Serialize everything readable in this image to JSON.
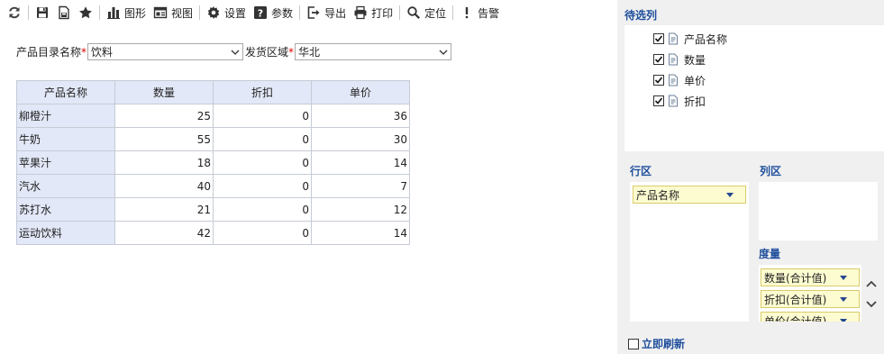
{
  "toolbar": {
    "chart_label": "图形",
    "view_label": "视图",
    "settings_label": "设置",
    "params_label": "参数",
    "export_label": "导出",
    "print_label": "打印",
    "locate_label": "定位",
    "alert_label": "告警"
  },
  "filters": {
    "catalog_label": "产品目录名称",
    "catalog_value": "饮料",
    "region_label": "发货区域",
    "region_value": "华北",
    "required_mark": "*"
  },
  "table": {
    "headers": [
      "产品名称",
      "数量",
      "折扣",
      "单价"
    ],
    "rows": [
      {
        "name": "柳橙汁",
        "qty": "25",
        "discount": "0",
        "price": "36"
      },
      {
        "name": "牛奶",
        "qty": "55",
        "discount": "0",
        "price": "30"
      },
      {
        "name": "苹果汁",
        "qty": "18",
        "discount": "0",
        "price": "14"
      },
      {
        "name": "汽水",
        "qty": "40",
        "discount": "0",
        "price": "7"
      },
      {
        "name": "苏打水",
        "qty": "21",
        "discount": "0",
        "price": "12"
      },
      {
        "name": "运动饮料",
        "qty": "42",
        "discount": "0",
        "price": "14"
      }
    ]
  },
  "panel": {
    "candidates_title": "待选列",
    "candidates": [
      "产品名称",
      "数量",
      "单价",
      "折扣"
    ],
    "rows_title": "行区",
    "cols_title": "列区",
    "measures_title": "度量",
    "row_fields": [
      "产品名称"
    ],
    "measures": [
      "数量(合计值)",
      "折扣(合计值)",
      "单价(合计值)"
    ],
    "refresh_label": "立即刷新"
  },
  "colors": {
    "accent": "#1f4e9c",
    "header_bg": "#e3e8f8",
    "chip_bg": "#fdfbd0",
    "required": "#dd0000"
  }
}
